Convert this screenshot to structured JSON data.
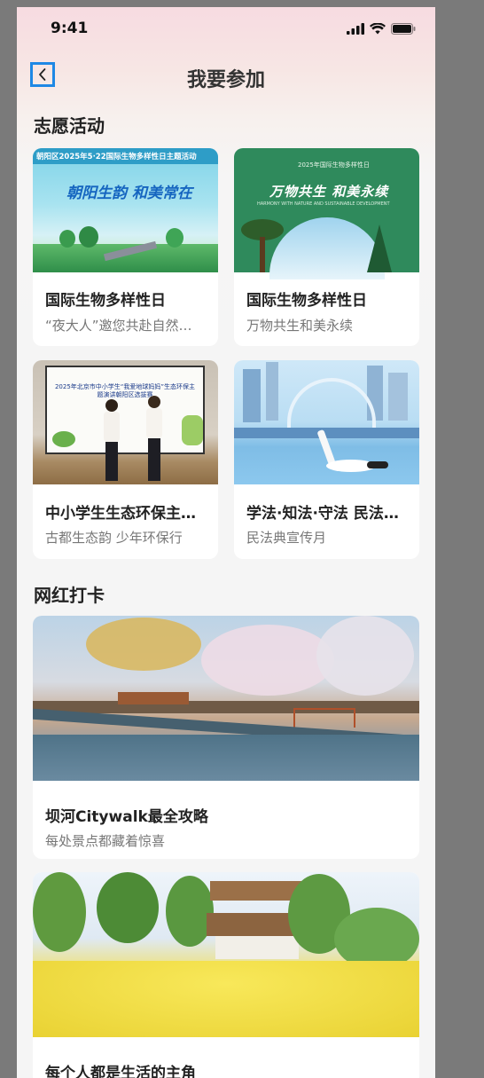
{
  "status_bar": {
    "time": "9:41"
  },
  "nav": {
    "title": "我要参加"
  },
  "sections": {
    "volunteer": {
      "title": "志愿活动"
    },
    "checkin": {
      "title": "网红打卡"
    }
  },
  "volunteer_cards": [
    {
      "title": "国际生物多样性日",
      "subtitle": "“夜大人”邀您共赴自然之约",
      "image_header": "朝阳区2025年5·22国际生物多样性日主题活动",
      "image_slogan": "朝阳生韵 和美常在"
    },
    {
      "title": "国际生物多样性日",
      "subtitle": "万物共生和美永续",
      "image_header": "2025年国际生物多样性日",
      "image_slogan": "万物共生 和美永续",
      "image_caption": "HARMONY WITH NATURE AND SUSTAINABLE DEVELOPMENT"
    },
    {
      "title": "中小学生生态环保主题演讲",
      "subtitle": "古都生态韵 少年环保行",
      "image_header": "2025年北京市中小学生“我爱地球妈妈”生态环保主题演讲朝阳区选拔赛"
    },
    {
      "title": "学法·知法·守法 民法典宣传",
      "subtitle": "民法典宣传月"
    }
  ],
  "checkin_cards": [
    {
      "title": "坝河Citywalk最全攻略",
      "subtitle": "每处景点都藏着惊喜"
    },
    {
      "title": "每个人都是生活的主角",
      "subtitle": ""
    }
  ],
  "colors": {
    "accent_blue": "#1e88e5",
    "card_bg": "#ffffff",
    "page_bg": "#f5f5f5"
  }
}
